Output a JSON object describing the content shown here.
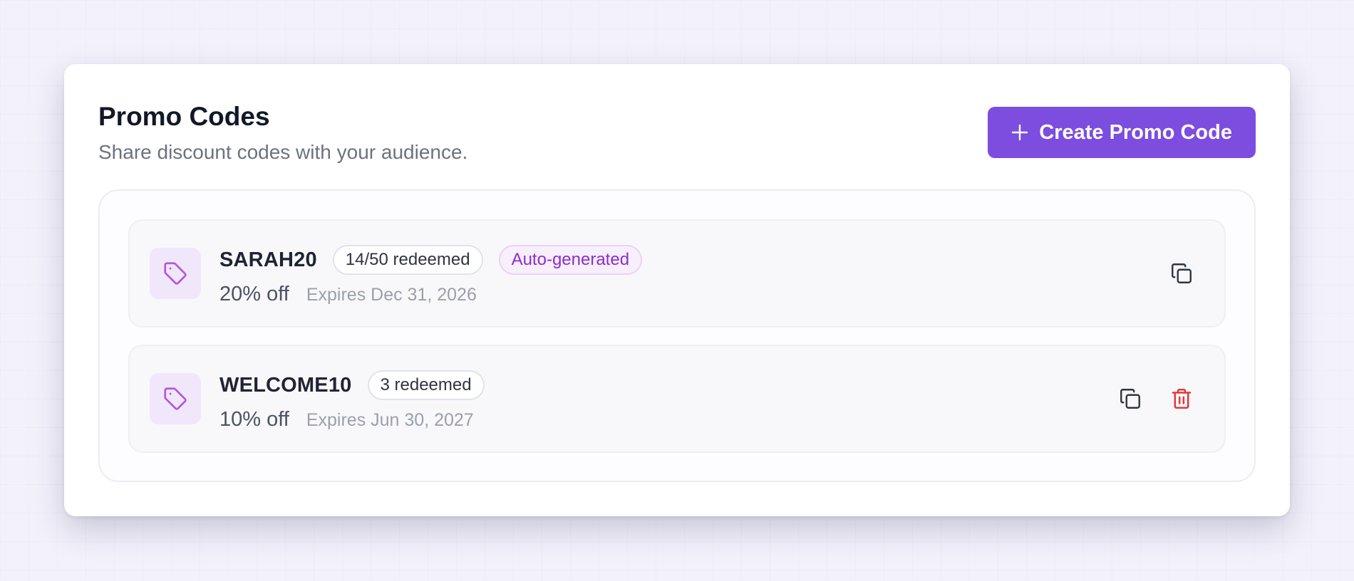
{
  "header": {
    "title": "Promo Codes",
    "subtitle": "Share discount codes with your audience.",
    "create_label": "Create Promo Code"
  },
  "colors": {
    "accent": "#7c4ddf",
    "tag_tile_bg": "#f1e7fb",
    "tag_icon": "#b05ad9",
    "auto_badge_text": "#8a2fc9",
    "delete_red": "#e03a3a"
  },
  "icons": {
    "create": "plus-icon",
    "tag": "tag-icon",
    "copy": "copy-icon",
    "delete": "trash-icon"
  },
  "promos": [
    {
      "code": "SARAH20",
      "redeemed": "14/50 redeemed",
      "auto_badge": "Auto-generated",
      "discount": "20% off",
      "expires": "Expires Dec 31, 2026",
      "can_delete": false
    },
    {
      "code": "WELCOME10",
      "redeemed": "3 redeemed",
      "discount": "10% off",
      "expires": "Expires Jun 30, 2027",
      "can_delete": true
    }
  ]
}
